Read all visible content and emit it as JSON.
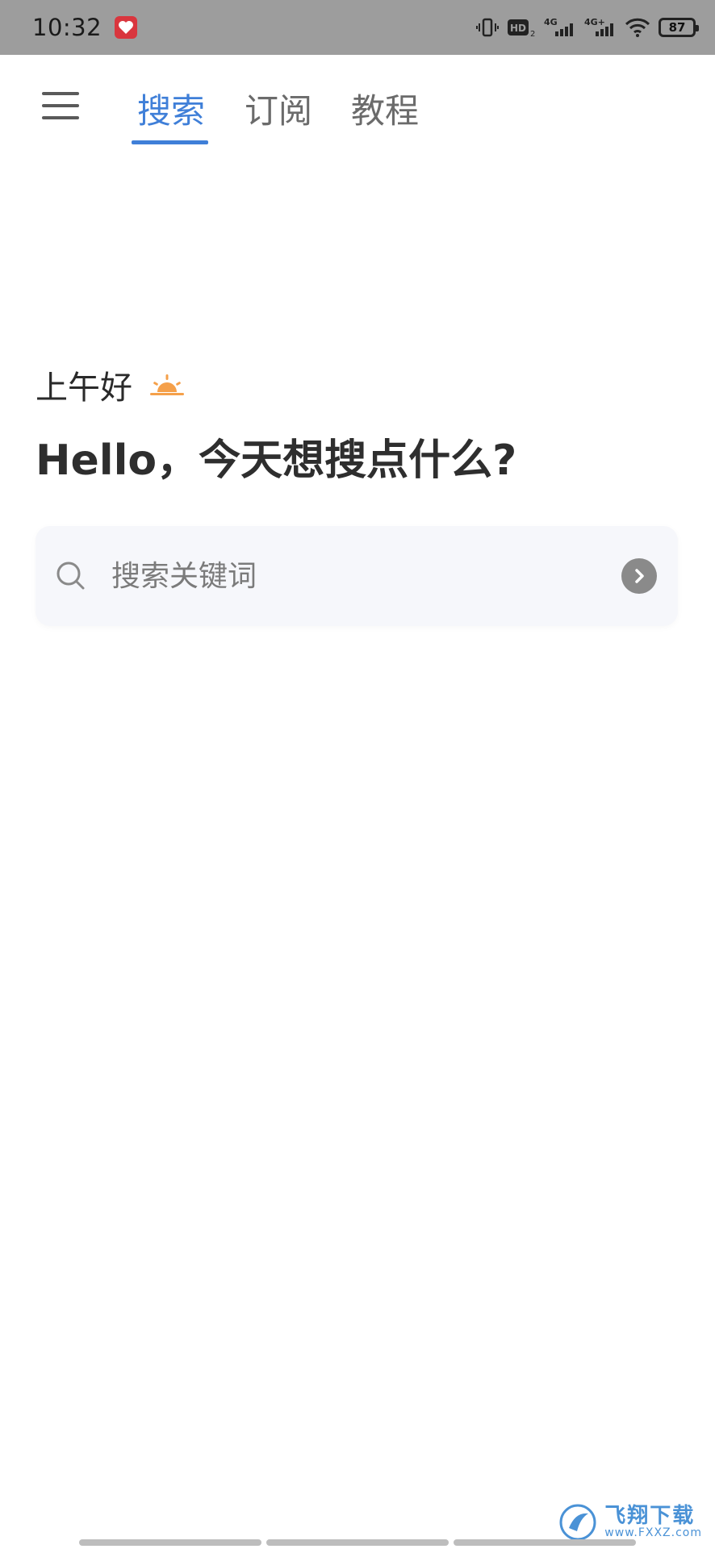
{
  "status_bar": {
    "time": "10:32",
    "battery": "87",
    "icons": [
      "vibrate-icon",
      "hd-icon",
      "4g-signal-icon",
      "4g-plus-signal-icon",
      "wifi-icon",
      "battery-icon"
    ]
  },
  "nav": {
    "tabs": [
      {
        "label": "搜索",
        "active": true
      },
      {
        "label": "订阅",
        "active": false
      },
      {
        "label": "教程",
        "active": false
      }
    ],
    "accent_color": "#3f7fd8"
  },
  "greeting": {
    "period": "上午好",
    "headline": "Hello，今天想搜点什么?"
  },
  "search": {
    "placeholder": "搜索关键词",
    "value": ""
  },
  "watermark": {
    "name": "飞翔下载",
    "url": "www.FXXZ.com"
  }
}
